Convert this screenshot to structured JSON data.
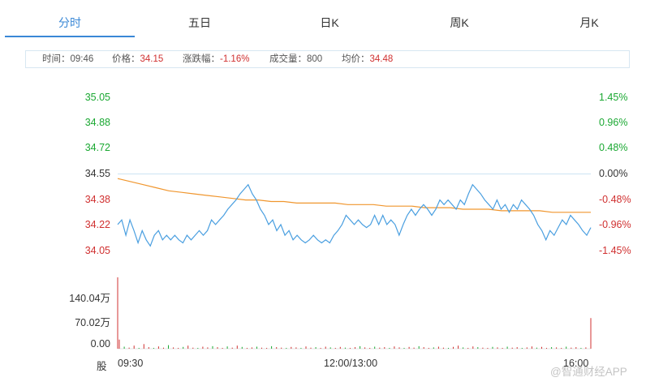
{
  "tabs": [
    {
      "label": "分时",
      "active": true
    },
    {
      "label": "五日",
      "active": false
    },
    {
      "label": "日K",
      "active": false
    },
    {
      "label": "周K",
      "active": false
    },
    {
      "label": "月K",
      "active": false
    }
  ],
  "info": {
    "time_label": "时间：",
    "time": "09:46",
    "price_label": "价格：",
    "price": "34.15",
    "change_label": "涨跌幅：",
    "change": "-1.16%",
    "volume_label": "成交量：",
    "volume": "800",
    "avg_label": "均价：",
    "avg": "34.48"
  },
  "colors": {
    "accent": "#3a88d6",
    "price_line": "#4a9fe0",
    "avg_line": "#f0962e",
    "up": "#d03030",
    "down": "#1aa832",
    "baseline": "#cde4f3"
  },
  "chart_data": {
    "type": "line",
    "price_axis": [
      "35.05",
      "34.88",
      "34.72",
      "34.55",
      "34.38",
      "34.22",
      "34.05"
    ],
    "percent_axis": [
      "1.45%",
      "0.96%",
      "0.48%",
      "0.00%",
      "-0.48%",
      "-0.96%",
      "-1.45%"
    ],
    "volume_axis": [
      "140.04万",
      "70.02万",
      "0.00"
    ],
    "volume_unit": "股",
    "x_labels": [
      "09:30",
      "12:00/13:00",
      "16:00"
    ],
    "ylim": [
      34.05,
      35.05
    ],
    "volume_max": 1400400,
    "series": [
      {
        "values": [
          34.22,
          34.25,
          34.15,
          34.25,
          34.18,
          34.1,
          34.18,
          34.12,
          34.08,
          34.15,
          34.18,
          34.12,
          34.15,
          34.12,
          34.15,
          34.12,
          34.1,
          34.15,
          34.12,
          34.15,
          34.18,
          34.15,
          34.18,
          34.25,
          34.22,
          34.25,
          34.28,
          34.32,
          34.35,
          34.38,
          34.42,
          34.45,
          34.48,
          34.42,
          34.38,
          34.32,
          34.28,
          34.22,
          34.25,
          34.18,
          34.22,
          34.15,
          34.18,
          34.12,
          34.15,
          34.12,
          34.1,
          34.12,
          34.15,
          34.12,
          34.1,
          34.12,
          34.1,
          34.15,
          34.18,
          34.22,
          34.28,
          34.25,
          34.22,
          34.25,
          34.22,
          34.2,
          34.22,
          34.28,
          34.22,
          34.28,
          34.22,
          34.25,
          34.22,
          34.15,
          34.22,
          34.28,
          34.32,
          34.28,
          34.32,
          34.35,
          34.32,
          34.28,
          34.32,
          34.38,
          34.35,
          34.38,
          34.35,
          34.32,
          34.38,
          34.35,
          34.42,
          34.48,
          34.45,
          34.42,
          34.38,
          34.35,
          34.32,
          34.38,
          34.32,
          34.35,
          34.3,
          34.35,
          34.32,
          34.38,
          34.35,
          34.32,
          34.28,
          34.22,
          34.18,
          34.12,
          34.18,
          34.15,
          34.2,
          34.25,
          34.22,
          34.28,
          34.25,
          34.22,
          34.18,
          34.15,
          34.2
        ],
        "name": ""
      },
      {
        "values": [
          34.52,
          34.5,
          34.48,
          34.46,
          34.44,
          34.43,
          34.42,
          34.41,
          34.4,
          34.39,
          34.38,
          34.38,
          34.37,
          34.37,
          34.36,
          34.36,
          34.36,
          34.36,
          34.35,
          34.35,
          34.35,
          34.34,
          34.34,
          34.34,
          34.33,
          34.33,
          34.33,
          34.32,
          34.32,
          34.32,
          34.31,
          34.31,
          34.31,
          34.31,
          34.3,
          34.3,
          34.3,
          34.3
        ],
        "name": ""
      }
    ],
    "volume": [
      180000,
      40000,
      20000,
      60000,
      15000,
      90000,
      30000,
      10000,
      45000,
      20000,
      70000,
      25000,
      15000,
      35000,
      60000,
      20000,
      10000,
      40000,
      25000,
      50000,
      30000,
      15000,
      45000,
      20000,
      60000,
      35000,
      10000,
      25000,
      40000,
      20000,
      15000,
      50000,
      30000,
      20000,
      10000,
      35000,
      25000,
      15000,
      45000,
      20000,
      30000,
      10000,
      40000,
      25000,
      15000,
      35000,
      20000,
      10000,
      30000,
      50000,
      25000,
      15000,
      40000,
      20000,
      30000,
      15000,
      45000,
      25000,
      10000,
      35000,
      20000,
      50000,
      30000,
      15000,
      25000,
      40000,
      20000,
      10000,
      35000,
      60000,
      25000,
      15000,
      45000,
      30000,
      20000,
      10000,
      35000,
      25000,
      15000,
      40000,
      20000,
      30000,
      15000,
      25000,
      45000,
      20000,
      35000,
      10000,
      30000,
      25000,
      15000,
      40000,
      20000,
      30000,
      10000,
      25000,
      600000
    ]
  },
  "watermark": "@智通财经APP"
}
